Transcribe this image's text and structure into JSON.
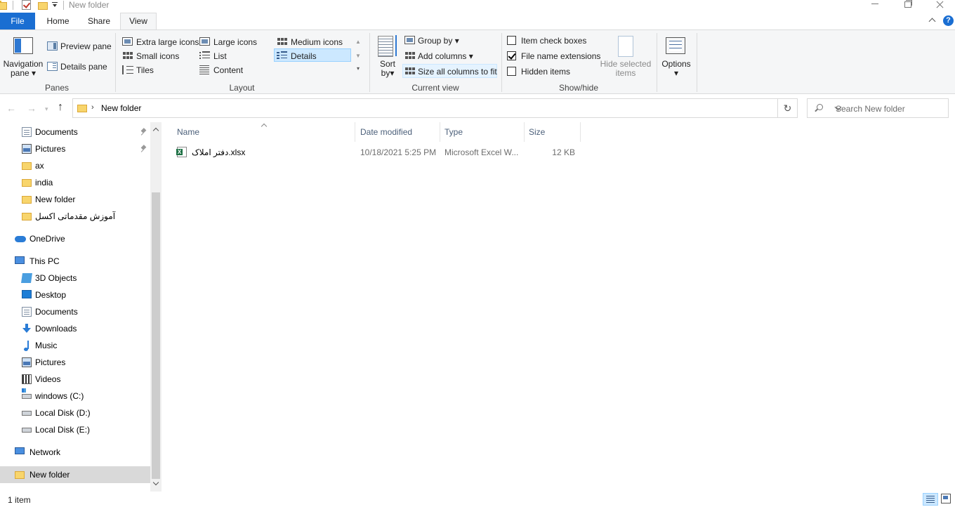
{
  "window": {
    "title": "New folder"
  },
  "tabs": {
    "file": "File",
    "home": "Home",
    "share": "Share",
    "view": "View"
  },
  "ribbon": {
    "panes": {
      "navigation_pane": "Navigation",
      "navigation_pane_line2": "pane",
      "preview_pane": "Preview pane",
      "details_pane": "Details pane",
      "label": "Panes"
    },
    "layout": {
      "extra_large_icons": "Extra large icons",
      "large_icons": "Large icons",
      "medium_icons": "Medium icons",
      "small_icons": "Small icons",
      "list": "List",
      "details": "Details",
      "tiles": "Tiles",
      "content": "Content",
      "label": "Layout",
      "selected": "Details"
    },
    "current_view": {
      "sort_by": "Sort",
      "sort_by_line2": "by",
      "group_by": "Group by",
      "add_columns": "Add columns",
      "size_all_columns": "Size all columns to fit",
      "label": "Current view"
    },
    "show_hide": {
      "item_check_boxes": "Item check boxes",
      "item_check_boxes_checked": false,
      "file_name_extensions": "File name extensions",
      "file_name_extensions_checked": true,
      "hidden_items": "Hidden items",
      "hidden_items_checked": false,
      "hide_selected_items": "Hide selected",
      "hide_selected_items_line2": "items",
      "label": "Show/hide"
    },
    "options": {
      "label": "Options"
    }
  },
  "address": {
    "path": "New folder",
    "search_placeholder": "Search New folder"
  },
  "nav": {
    "quick_access": [
      {
        "label": "Documents",
        "icon": "documents-icon",
        "pinned": true
      },
      {
        "label": "Pictures",
        "icon": "pictures-icon",
        "pinned": true
      },
      {
        "label": "ax",
        "icon": "folder-icon",
        "pinned": false
      },
      {
        "label": "india",
        "icon": "folder-icon",
        "pinned": false
      },
      {
        "label": "New folder",
        "icon": "folder-icon",
        "pinned": false
      },
      {
        "label": "آموزش مقدماتی اکسل",
        "icon": "folder-icon",
        "pinned": false
      }
    ],
    "onedrive": "OneDrive",
    "this_pc": "This PC",
    "this_pc_items": [
      {
        "label": "3D Objects",
        "icon": "3d-objects-icon"
      },
      {
        "label": "Desktop",
        "icon": "desktop-icon"
      },
      {
        "label": "Documents",
        "icon": "documents-icon"
      },
      {
        "label": "Downloads",
        "icon": "downloads-icon"
      },
      {
        "label": "Music",
        "icon": "music-icon"
      },
      {
        "label": "Pictures",
        "icon": "pictures-icon"
      },
      {
        "label": "Videos",
        "icon": "videos-icon"
      },
      {
        "label": "windows (C:)",
        "icon": "windows-drive-icon"
      },
      {
        "label": "Local Disk (D:)",
        "icon": "drive-icon"
      },
      {
        "label": "Local Disk (E:)",
        "icon": "drive-icon"
      }
    ],
    "network": "Network",
    "selected": "New folder"
  },
  "columns": {
    "name": "Name",
    "date_modified": "Date modified",
    "type": "Type",
    "size": "Size"
  },
  "files": [
    {
      "name": "دفتر املاک.xlsx",
      "date_modified": "10/18/2021 5:25 PM",
      "type": "Microsoft Excel W...",
      "size": "12 KB",
      "icon": "excel-file-icon"
    }
  ],
  "status": {
    "item_count": "1 item"
  },
  "colors": {
    "accent": "#1a6ed2",
    "selection": "#cce8ff",
    "nav_selected": "#d9d9d9"
  }
}
